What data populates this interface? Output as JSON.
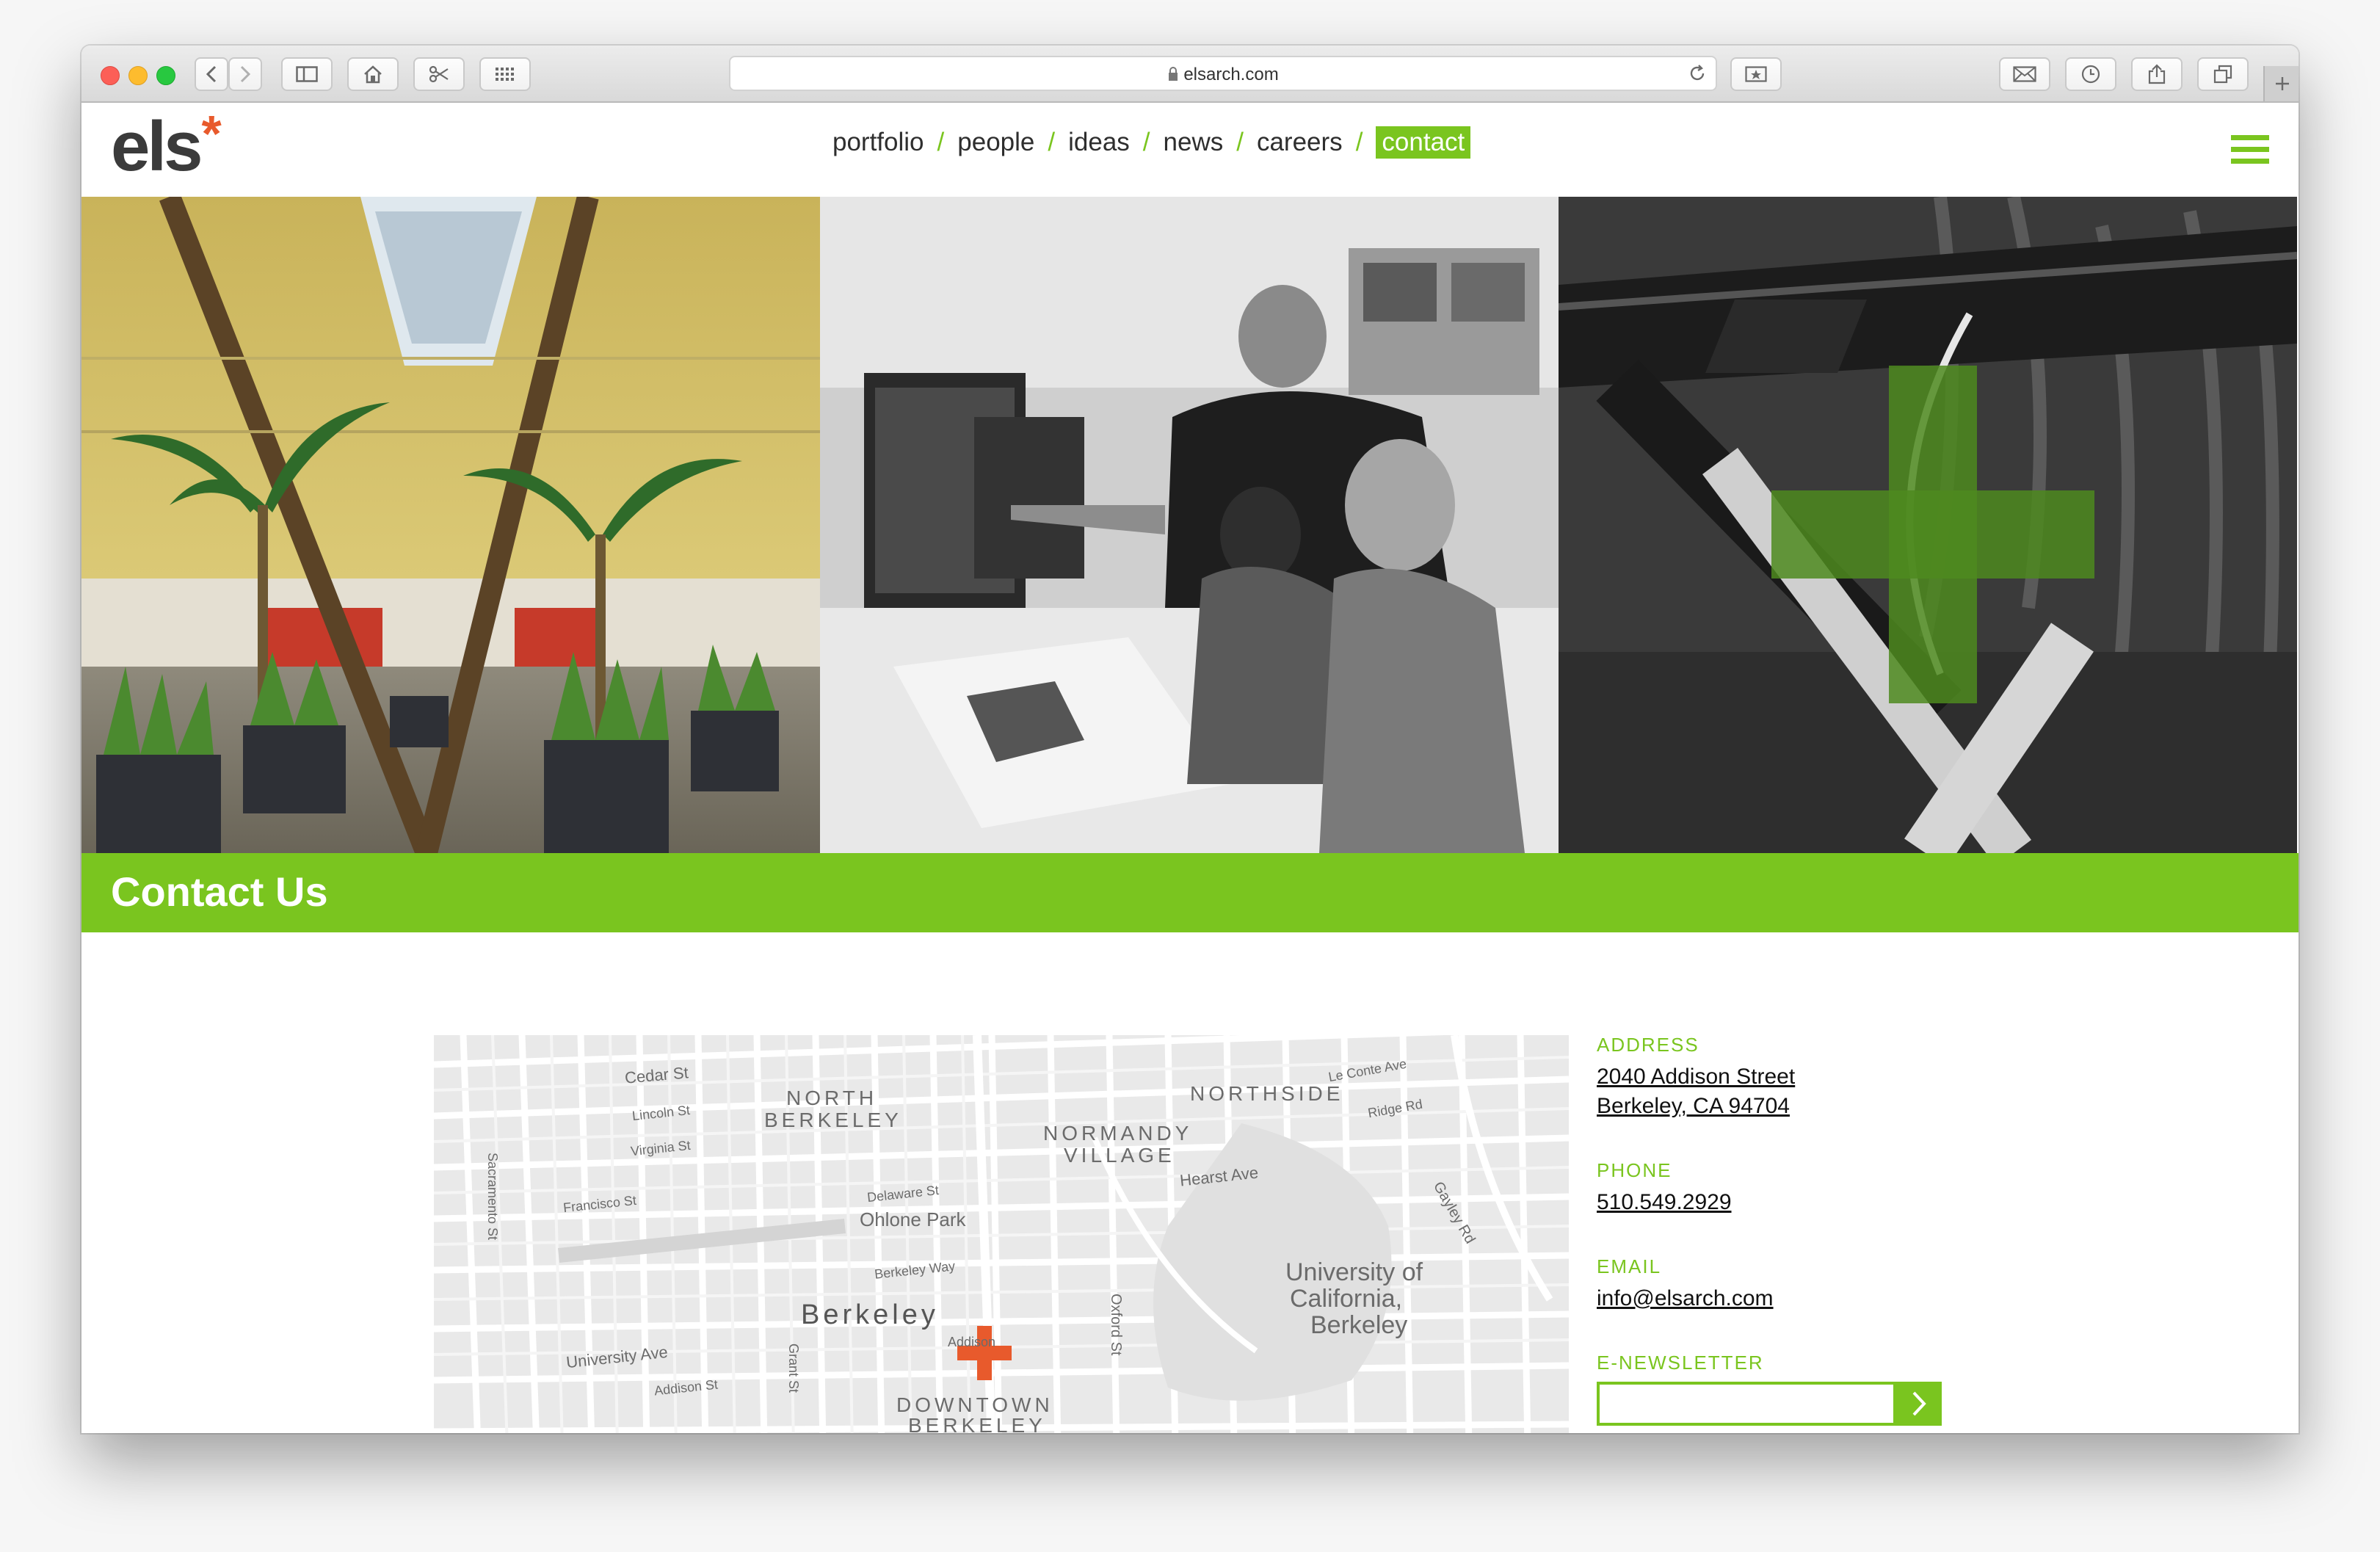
{
  "browser": {
    "url": "elsarch.com",
    "icons": [
      "back-icon",
      "forward-icon",
      "sidebar-icon",
      "home-icon",
      "scissors-icon",
      "grid-icon",
      "lock-icon",
      "reload-icon",
      "reader-icon",
      "mail-icon",
      "history-icon",
      "share-icon",
      "tabs-icon",
      "new-tab-icon"
    ]
  },
  "site": {
    "logo_text": "els",
    "logo_mark": "*",
    "nav": [
      {
        "label": "portfolio"
      },
      {
        "label": "people"
      },
      {
        "label": "ideas"
      },
      {
        "label": "news"
      },
      {
        "label": "careers"
      },
      {
        "label": "contact",
        "active": true
      }
    ],
    "nav_separator": "/",
    "accent_color": "#7ac51f",
    "brand_orange": "#e85a2c"
  },
  "banner": {
    "title": "Contact Us"
  },
  "map": {
    "labels": [
      {
        "text": "NORTH",
        "style": "area"
      },
      {
        "text": "BERKELEY",
        "style": "area"
      },
      {
        "text": "NORTHSIDE",
        "style": "area"
      },
      {
        "text": "NORMANDY",
        "style": "area"
      },
      {
        "text": "VILLAGE",
        "style": "area"
      },
      {
        "text": "Berkeley",
        "style": "city"
      },
      {
        "text": "DOWNTOWN",
        "style": "area"
      },
      {
        "text": "BERKELEY",
        "style": "area"
      },
      {
        "text": "Ohlone Park",
        "style": "park"
      },
      {
        "text": "University of",
        "style": "park"
      },
      {
        "text": "California,",
        "style": "park"
      },
      {
        "text": "Berkeley",
        "style": "park"
      },
      {
        "text": "Cedar St",
        "style": "street"
      },
      {
        "text": "Hearst Ave",
        "style": "street"
      },
      {
        "text": "University Ave",
        "style": "street"
      },
      {
        "text": "Addison St",
        "style": "street"
      },
      {
        "text": "Francisco St",
        "style": "street"
      },
      {
        "text": "Delaware St",
        "style": "street"
      },
      {
        "text": "Berkeley Way",
        "style": "street"
      },
      {
        "text": "Virginia St",
        "style": "street"
      },
      {
        "text": "Lincoln St",
        "style": "street"
      },
      {
        "text": "Sacramento St",
        "style": "street"
      },
      {
        "text": "Oxford St",
        "style": "street"
      },
      {
        "text": "Grant St",
        "style": "street"
      },
      {
        "text": "Ridge Rd",
        "style": "street"
      },
      {
        "text": "Le Conte Ave",
        "style": "street"
      },
      {
        "text": "Gayley Rd",
        "style": "street"
      },
      {
        "text": "Addison",
        "style": "street"
      }
    ]
  },
  "contact": {
    "address_label": "ADDRESS",
    "address_line1": "2040 Addison Street",
    "address_line2": "Berkeley, CA 94704",
    "phone_label": "PHONE",
    "phone": "510.549.2929",
    "email_label": "EMAIL",
    "email": "info@elsarch.com",
    "newsletter_label": "E-NEWSLETTER",
    "newsletter_value": ""
  }
}
